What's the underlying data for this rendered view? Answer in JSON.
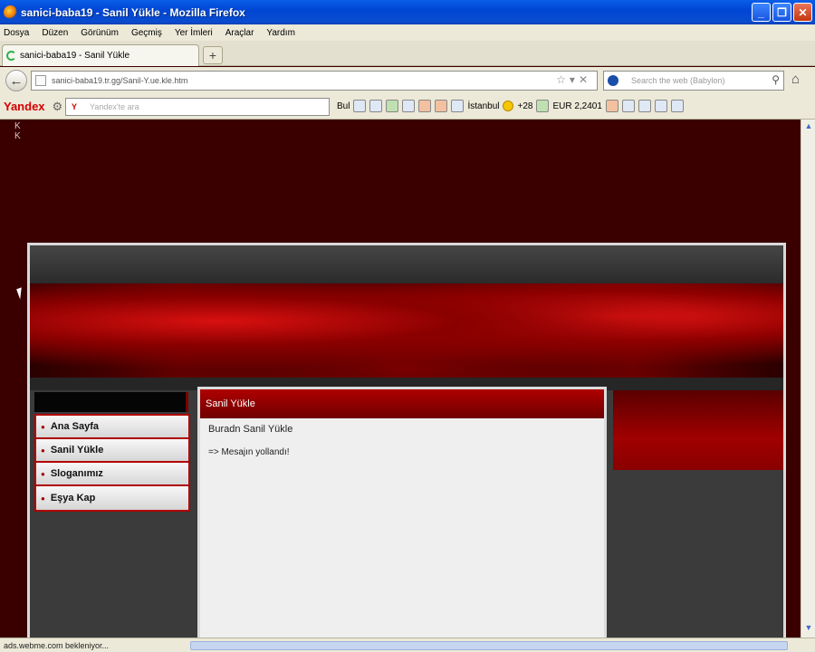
{
  "window": {
    "title": "sanici-baba19 - Sanil Yükle - Mozilla Firefox",
    "controls": [
      "_",
      "❐",
      "✕"
    ]
  },
  "menubar": [
    "Dosya",
    "Düzen",
    "Görünüm",
    "Geçmiş",
    "Yer İmleri",
    "Araçlar",
    "Yardım"
  ],
  "tabs": [
    {
      "label": "sanici-baba19 - Sanil Yükle"
    }
  ],
  "nav": {
    "url": "sanici-baba19.tr.gg/Sanil-Y.ue.kle.htm",
    "search_placeholder": "Search the web (Babylon)"
  },
  "yandex": {
    "logo": "Yandex",
    "search_placeholder": "Yandex'te ara",
    "find_label": "Bul",
    "city": "İstanbul",
    "temperature": "+28",
    "currency": "EUR 2,2401"
  },
  "page": {
    "corner_text": "K\nK",
    "sidebar_menu": [
      "Ana Sayfa",
      "Sanil Yükle",
      "Sloganımız",
      "Eşya Kap"
    ],
    "content_title": "Sanil Yükle",
    "content_line": "Buradn Sanil Yükle",
    "content_message": "=> Mesajın yollandı!"
  },
  "status": {
    "text": "ads.webme.com bekleniyor..."
  }
}
